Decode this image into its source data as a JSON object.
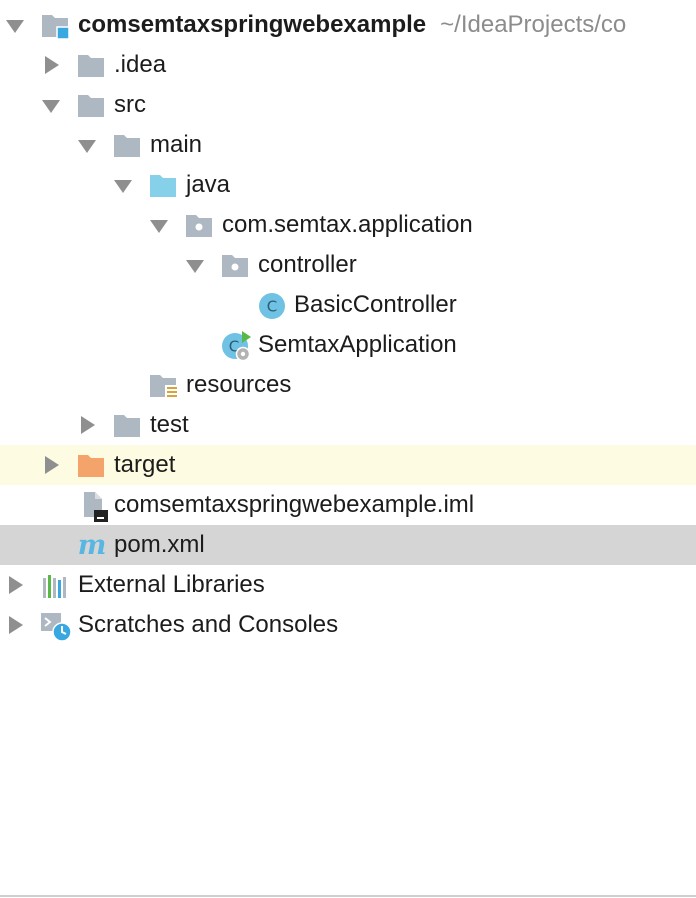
{
  "project": {
    "name": "comsemtaxspringwebexample",
    "path": "~/IdeaProjects/co"
  },
  "tree": {
    "idea": ".idea",
    "src": "src",
    "main": "main",
    "java": "java",
    "package": "com.semtax.application",
    "controller": "controller",
    "basic_controller": "BasicController",
    "semtax_application": "SemtaxApplication",
    "resources": "resources",
    "test": "test",
    "target": "target",
    "iml": "comsemtaxspringwebexample.iml",
    "pom": "pom.xml",
    "external_libraries": "External Libraries",
    "scratches": "Scratches and Consoles"
  },
  "icon_glyphs": {
    "class": "C",
    "maven": "m"
  },
  "colors": {
    "folder_gray": "#aeb8c2",
    "folder_blue": "#87d0ea",
    "folder_orange": "#f4a36b",
    "class_blue": "#6fc2e4",
    "run_green": "#58b947",
    "hover_row": "#fdfbe1",
    "selected_row": "#d5d5d5",
    "module_accent": "#3aa8e0"
  }
}
